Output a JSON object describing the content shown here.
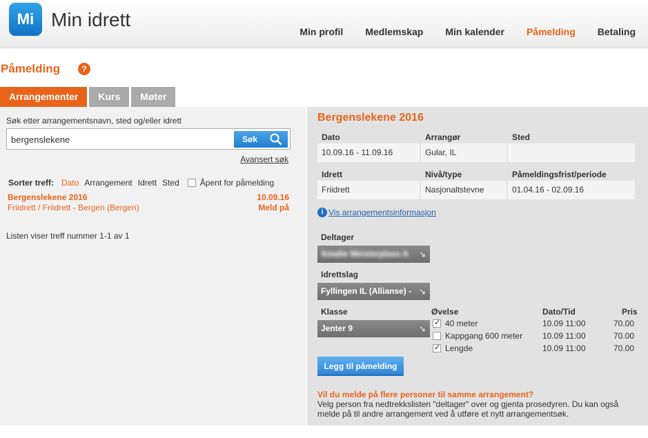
{
  "header": {
    "logo_mark": "Mi",
    "logo_text": "Min idrett",
    "nav": [
      "Min profil",
      "Medlemskap",
      "Min kalender",
      "Påmelding",
      "Betaling"
    ],
    "active_nav": "Påmelding"
  },
  "page": {
    "title": "Påmelding",
    "help": "?"
  },
  "tabs": [
    "Arrangementer",
    "Kurs",
    "Møter"
  ],
  "search": {
    "label": "Søk etter arrangementsnavn, sted og/eller idrett",
    "value": "bergenslekene",
    "button": "Søk",
    "advanced": "Avansert søk"
  },
  "sort": {
    "label": "Sorter treff:",
    "options": [
      "Dato",
      "Arrangement",
      "Idrett",
      "Sted"
    ],
    "active": "Dato",
    "open_label": "Åpent for påmelding"
  },
  "results": [
    {
      "name": "Bergenslekene 2016",
      "date": "10.09.16",
      "details": "Friidrett / Friidrett - Bergen (Bergen)",
      "action": "Meld på"
    }
  ],
  "list_info": "Listen viser treff nummer 1-1 av 1",
  "event": {
    "title": "Bergenslekene 2016",
    "headers1": [
      "Dato",
      "Arrangør",
      "Sted"
    ],
    "values1": [
      "10.09.16 - 11.09.16",
      "Gular, IL",
      ""
    ],
    "headers2": [
      "Idrett",
      "Nivå/type",
      "Påmeldingsfrist/periode"
    ],
    "values2": [
      "Friidrett",
      "Nasjonaltstevne",
      "01.04.16 - 02.09.16"
    ],
    "info_link": "Vis arrangementsinformasjon",
    "deltager_label": "Deltager",
    "deltager_value": "Amalie Meisterplass A",
    "idrettslag_label": "Idrettslag",
    "idrettslag_value": "Fyllingen IL (Allianse) -",
    "klasse_label": "Klasse",
    "klasse_value": "Jenter 9",
    "ovelse_headers": [
      "Øvelse",
      "Dato/Tid",
      "Pris"
    ],
    "ovelser": [
      {
        "name": "40 meter",
        "time": "10.09 11:00",
        "price": "70.00",
        "checked": true
      },
      {
        "name": "Kappgang 600 meter",
        "time": "10.09 11:00",
        "price": "70.00",
        "checked": false
      },
      {
        "name": "Lengde",
        "time": "10.09 11:00",
        "price": "70.00",
        "checked": true
      }
    ],
    "add_button": "Legg til påmelding",
    "multi_question": "Vil du melde på flere personer til samme arrangement?",
    "multi_text": "Velg person fra nedtrekkslisten \"deltager\" over og gjenta prosedyren. Du kan også melde på til andre arrangement ved å utføre et nytt arrangementsøk."
  },
  "colors": {
    "accent": "#e8641b",
    "link_blue": "#1f5fa8",
    "button_blue": "#2f86d6",
    "panel_gray": "#e2e2e2"
  }
}
